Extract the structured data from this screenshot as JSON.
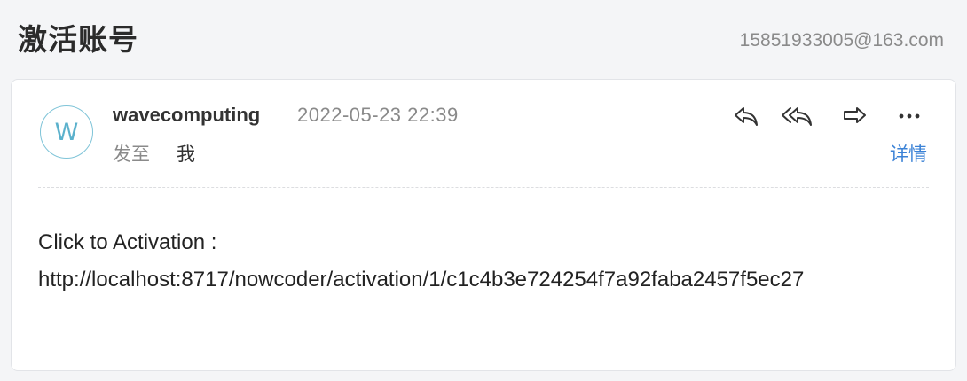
{
  "header": {
    "title": "激活账号",
    "account_email": "15851933005@163.com"
  },
  "message": {
    "avatar_letter": "W",
    "sender": "wavecomputing",
    "datetime": "2022-05-23 22:39",
    "to_label": "发至",
    "to_value": "我",
    "details_label": "详情",
    "body_line1": "Click to Activation :",
    "body_link": "http://localhost:8717/nowcoder/activation/1/c1c4b3e724254f7a92faba2457f5ec27"
  },
  "actions": [
    {
      "icon": "reply-icon"
    },
    {
      "icon": "reply-all-icon"
    },
    {
      "icon": "forward-icon"
    },
    {
      "icon": "more-icon"
    }
  ],
  "colors": {
    "accent": "#3b82d6",
    "avatar_ring": "#7fc4d8",
    "muted_text": "#8a8a8a",
    "background": "#f4f5f7"
  }
}
